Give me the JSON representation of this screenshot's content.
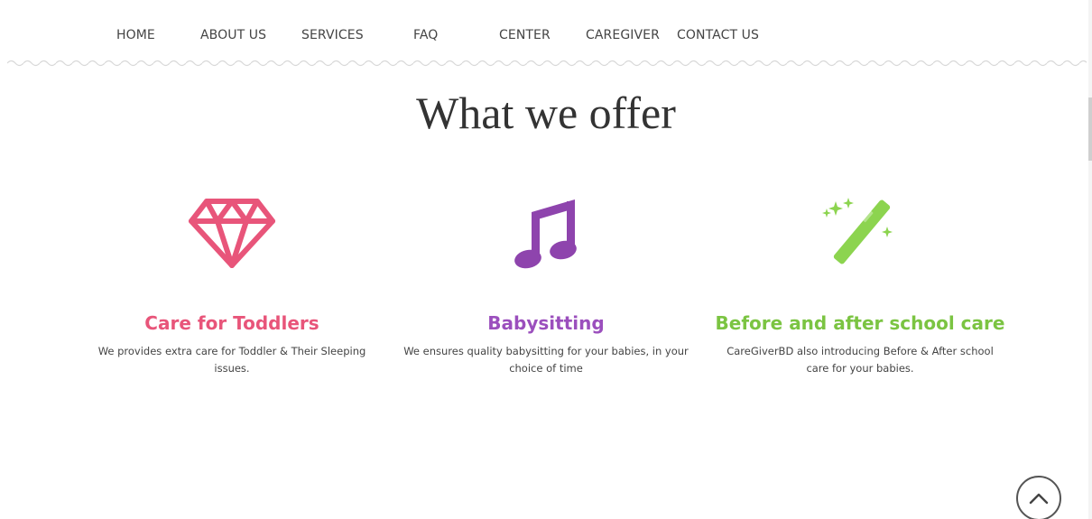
{
  "nav": {
    "items": [
      {
        "label": "HOME"
      },
      {
        "label": "ABOUT US"
      },
      {
        "label": "SERVICES"
      },
      {
        "label": "FAQ"
      },
      {
        "label": "CENTER"
      },
      {
        "label": "CAREGIVER"
      },
      {
        "label": "CONTACT US"
      }
    ]
  },
  "section": {
    "title": "What we offer"
  },
  "features": [
    {
      "icon": "diamond-icon",
      "color": "#e8557a",
      "title": "Care for Toddlers",
      "desc": "We provides extra care for Toddler & Their Sleeping issues."
    },
    {
      "icon": "music-note-icon",
      "color": "#9b4fbd",
      "title": "Babysitting",
      "desc": "We ensures quality babysitting for your babies, in your choice of time"
    },
    {
      "icon": "magic-wand-icon",
      "color": "#7bc442",
      "title": "Before and after school care",
      "desc": "CareGiverBD also introducing Before & After school care for your babies."
    }
  ],
  "back_to_top": {
    "icon": "chevron-up-icon"
  }
}
